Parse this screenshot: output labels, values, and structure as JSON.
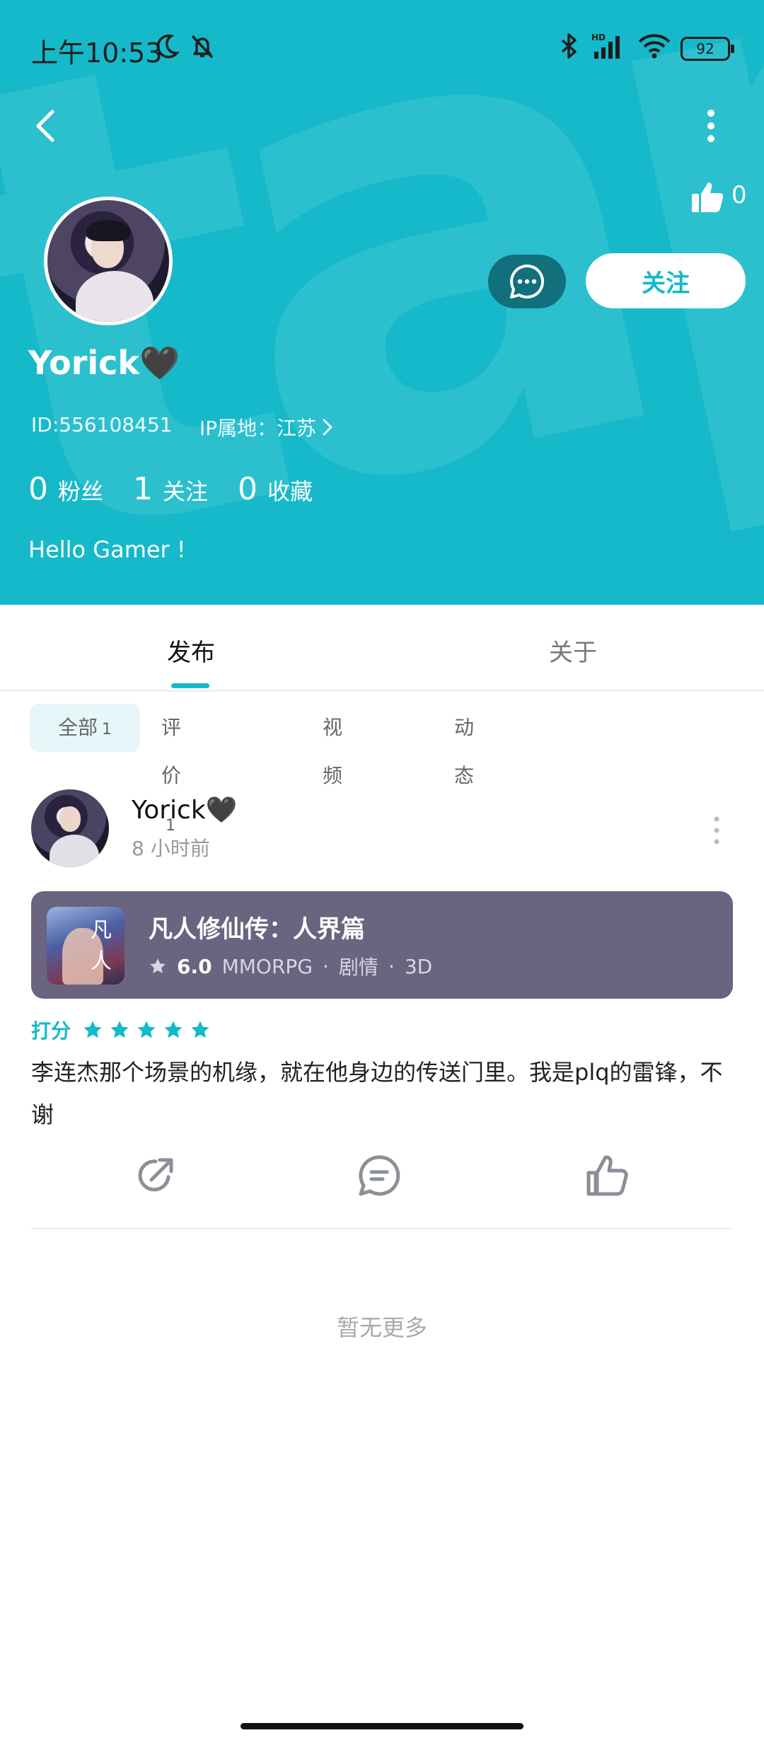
{
  "status_bar": {
    "time": "上午10:53",
    "battery": "92"
  },
  "header": {
    "like_count": "0",
    "follow_label": "关注",
    "username": "Yorick🖤",
    "id_text": "ID:556108451",
    "ip_text": "IP属地：江苏",
    "stats": [
      {
        "num": "0",
        "label": "粉丝"
      },
      {
        "num": "1",
        "label": "关注"
      },
      {
        "num": "0",
        "label": "收藏"
      }
    ],
    "bio": "Hello Gamer !"
  },
  "tabs": {
    "publish": "发布",
    "about": "关于"
  },
  "filters": [
    {
      "label": "全部",
      "count": "1"
    },
    {
      "label": "评价",
      "count": "1"
    },
    {
      "label": "视频",
      "count": ""
    },
    {
      "label": "动态",
      "count": ""
    }
  ],
  "post": {
    "author": "Yorick🖤",
    "time": "8 小时前",
    "game": {
      "title": "凡人修仙传：人界篇",
      "rating": "6.0",
      "genre": "MMORPG",
      "tag1": "剧情",
      "tag2": "3D"
    },
    "rating_label": "打分",
    "stars": 5,
    "text": "李连杰那个场景的机缘，就在他身边的传送门里。我是plq的雷锋，不谢"
  },
  "footer": {
    "no_more": "暂无更多"
  },
  "colors": {
    "accent": "#15b9c9",
    "card": "#6a6480"
  }
}
